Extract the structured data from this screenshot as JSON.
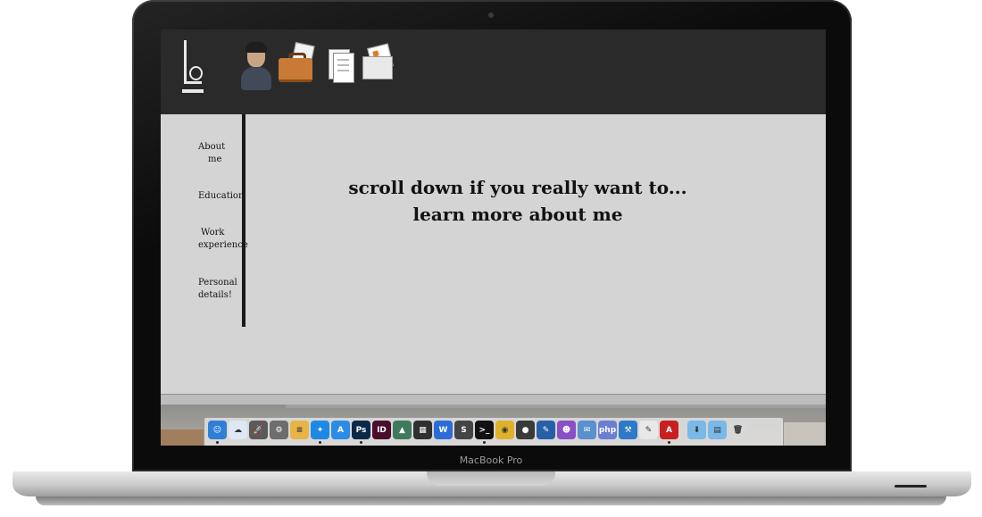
{
  "device": {
    "brand_label": "MacBook Pro"
  },
  "site": {
    "logo_letters": "Lo",
    "top_icons": [
      "user-avatar-icon",
      "briefcase-icon",
      "documents-icon",
      "envelope-icon"
    ],
    "nav": [
      {
        "id": "about",
        "lines": [
          "About",
          "me"
        ]
      },
      {
        "id": "education",
        "lines": [
          "Education"
        ]
      },
      {
        "id": "work",
        "lines": [
          "Work",
          "experience"
        ]
      },
      {
        "id": "personal",
        "lines": [
          "Personal",
          "details!"
        ]
      }
    ],
    "headline": [
      "scroll down if you really want to...",
      "learn more about me"
    ]
  },
  "dock": {
    "items": [
      {
        "name": "finder-icon",
        "color": "#2f7fd6",
        "glyph": "☺",
        "running": true
      },
      {
        "name": "icloud-icon",
        "color": "#dde8f5",
        "glyph": "☁",
        "running": false
      },
      {
        "name": "launchpad-icon",
        "color": "#5a5a5a",
        "glyph": "🚀",
        "running": false
      },
      {
        "name": "system-preferences-icon",
        "color": "#6d6d6d",
        "glyph": "⚙",
        "running": false
      },
      {
        "name": "notes-icon",
        "color": "#e8b446",
        "glyph": "≡",
        "running": false
      },
      {
        "name": "safari-icon",
        "color": "#1e88e5",
        "glyph": "✦",
        "running": true
      },
      {
        "name": "app-store-icon",
        "color": "#2b8ce6",
        "glyph": "A",
        "running": false
      },
      {
        "name": "photoshop-icon",
        "color": "#0b2a4a",
        "glyph": "Ps",
        "running": true
      },
      {
        "name": "indesign-icon",
        "color": "#4a0d2c",
        "glyph": "ID",
        "running": false
      },
      {
        "name": "photos-icon",
        "color": "#3f7a5c",
        "glyph": "▲",
        "running": false
      },
      {
        "name": "final-cut-icon",
        "color": "#303030",
        "glyph": "▦",
        "running": false
      },
      {
        "name": "word-icon",
        "color": "#2b6cd8",
        "glyph": "W",
        "running": false
      },
      {
        "name": "sublime-icon",
        "color": "#444444",
        "glyph": "S",
        "running": false
      },
      {
        "name": "terminal-icon",
        "color": "#111111",
        "glyph": ">_",
        "running": true
      },
      {
        "name": "chrome-icon",
        "color": "#e0b22a",
        "glyph": "◉",
        "running": false
      },
      {
        "name": "steam-icon",
        "color": "#3a3a3a",
        "glyph": "●",
        "running": false
      },
      {
        "name": "wireshark-icon",
        "color": "#2860a8",
        "glyph": "✎",
        "running": false
      },
      {
        "name": "github-icon",
        "color": "#8a4fc7",
        "glyph": "☻",
        "running": false
      },
      {
        "name": "mail-icon",
        "color": "#5a8fd0",
        "glyph": "✉",
        "running": false
      },
      {
        "name": "php-icon",
        "color": "#6a7fd1",
        "glyph": "php",
        "running": false
      },
      {
        "name": "xcode-icon",
        "color": "#2f79c9",
        "glyph": "⚒",
        "running": false
      },
      {
        "name": "pages-icon",
        "color": "#e8e8e8",
        "glyph": "✎",
        "running": false
      },
      {
        "name": "acrobat-icon",
        "color": "#c8201f",
        "glyph": "A",
        "running": true
      },
      {
        "name": "downloads-folder-icon",
        "color": "#7ab8e8",
        "glyph": "⬇",
        "running": false
      },
      {
        "name": "documents-folder-icon",
        "color": "#7ab8e8",
        "glyph": "▤",
        "running": false
      },
      {
        "name": "trash-icon",
        "color": "#d8d8d8",
        "glyph": "🗑",
        "running": false
      }
    ]
  }
}
